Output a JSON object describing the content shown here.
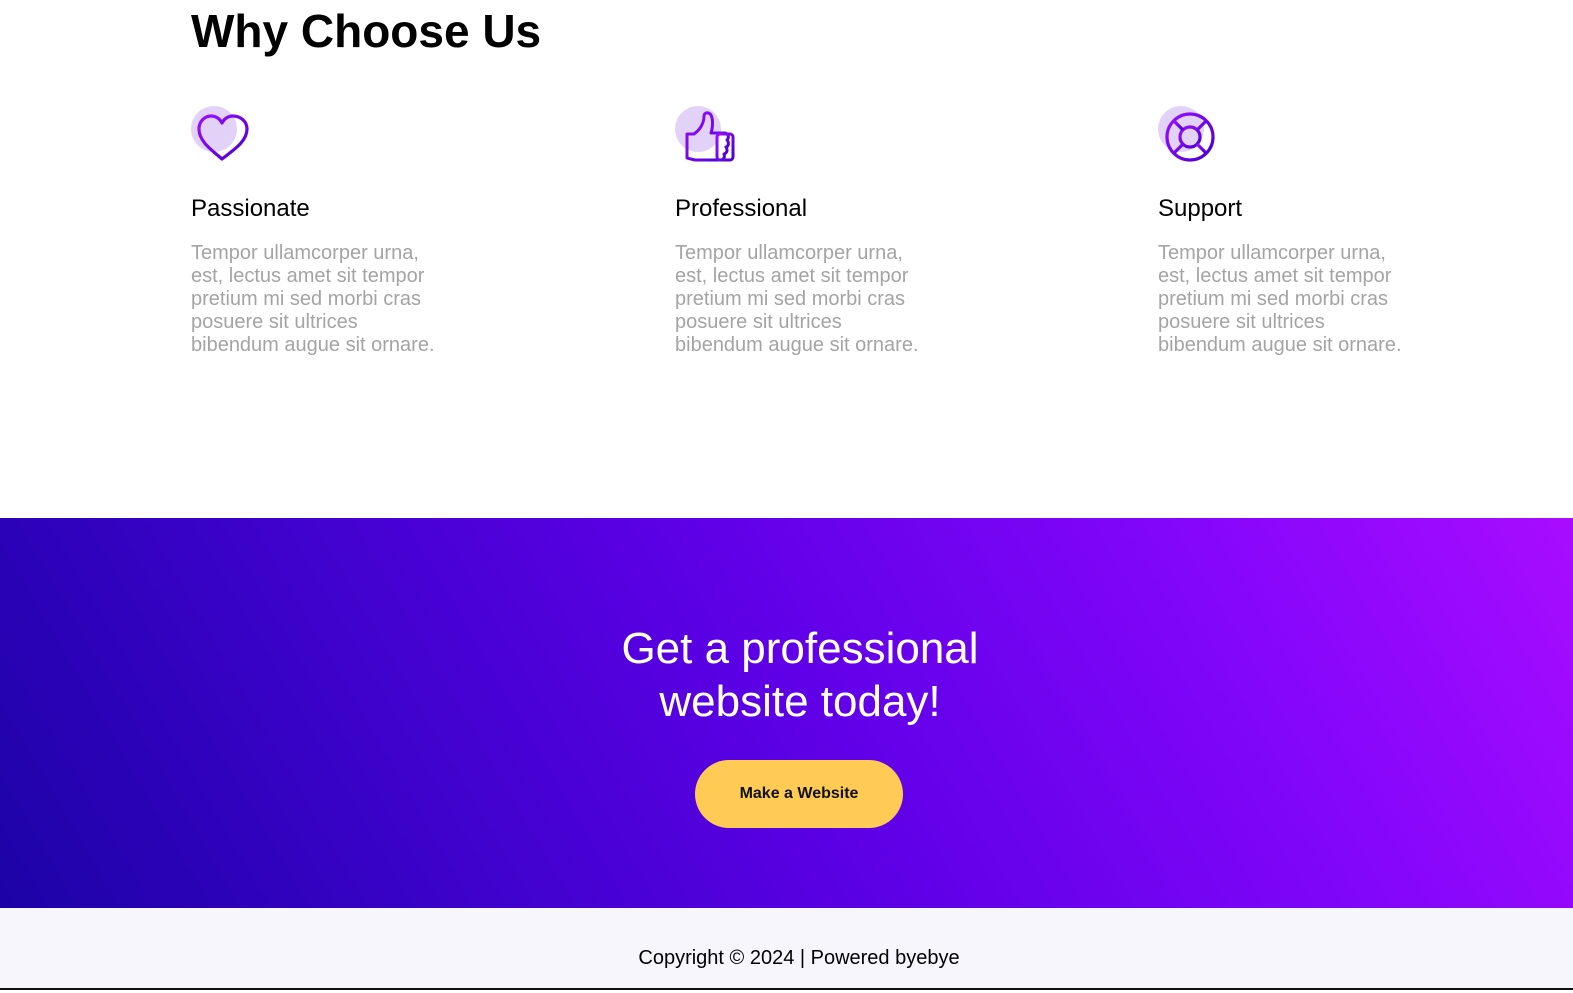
{
  "why": {
    "title": "Why Choose Us",
    "features": [
      {
        "icon": "heart-icon",
        "title": "Passionate",
        "text": "Tempor ullamcorper urna, est, lectus amet sit tempor pretium mi sed morbi cras posuere sit ultrices bibendum augue sit ornare."
      },
      {
        "icon": "thumbs-up-icon",
        "title": "Professional",
        "text": "Tempor ullamcorper urna, est, lectus amet sit tempor pretium mi sed morbi cras posuere sit ultrices bibendum augue sit ornare."
      },
      {
        "icon": "lifebuoy-icon",
        "title": "Support",
        "text": "Tempor ullamcorper urna, est, lectus amet sit tempor pretium mi sed morbi cras posuere sit ultrices bibendum augue sit ornare."
      }
    ]
  },
  "cta": {
    "heading_line1": "Get a professional",
    "heading_line2": "website today!",
    "button_label": "Make a Website"
  },
  "footer": {
    "copyright": "Copyright © 2024 | Powered byebye"
  },
  "colors": {
    "accent_purple": "#6a00f4",
    "icon_blob": "#e3d2f7",
    "button_yellow": "#ffcb54",
    "gradient_start": "#1c03a6",
    "gradient_end": "#a80cff",
    "footer_bg": "#f8f6fd",
    "body_text_gray": "#a4a4a4"
  }
}
